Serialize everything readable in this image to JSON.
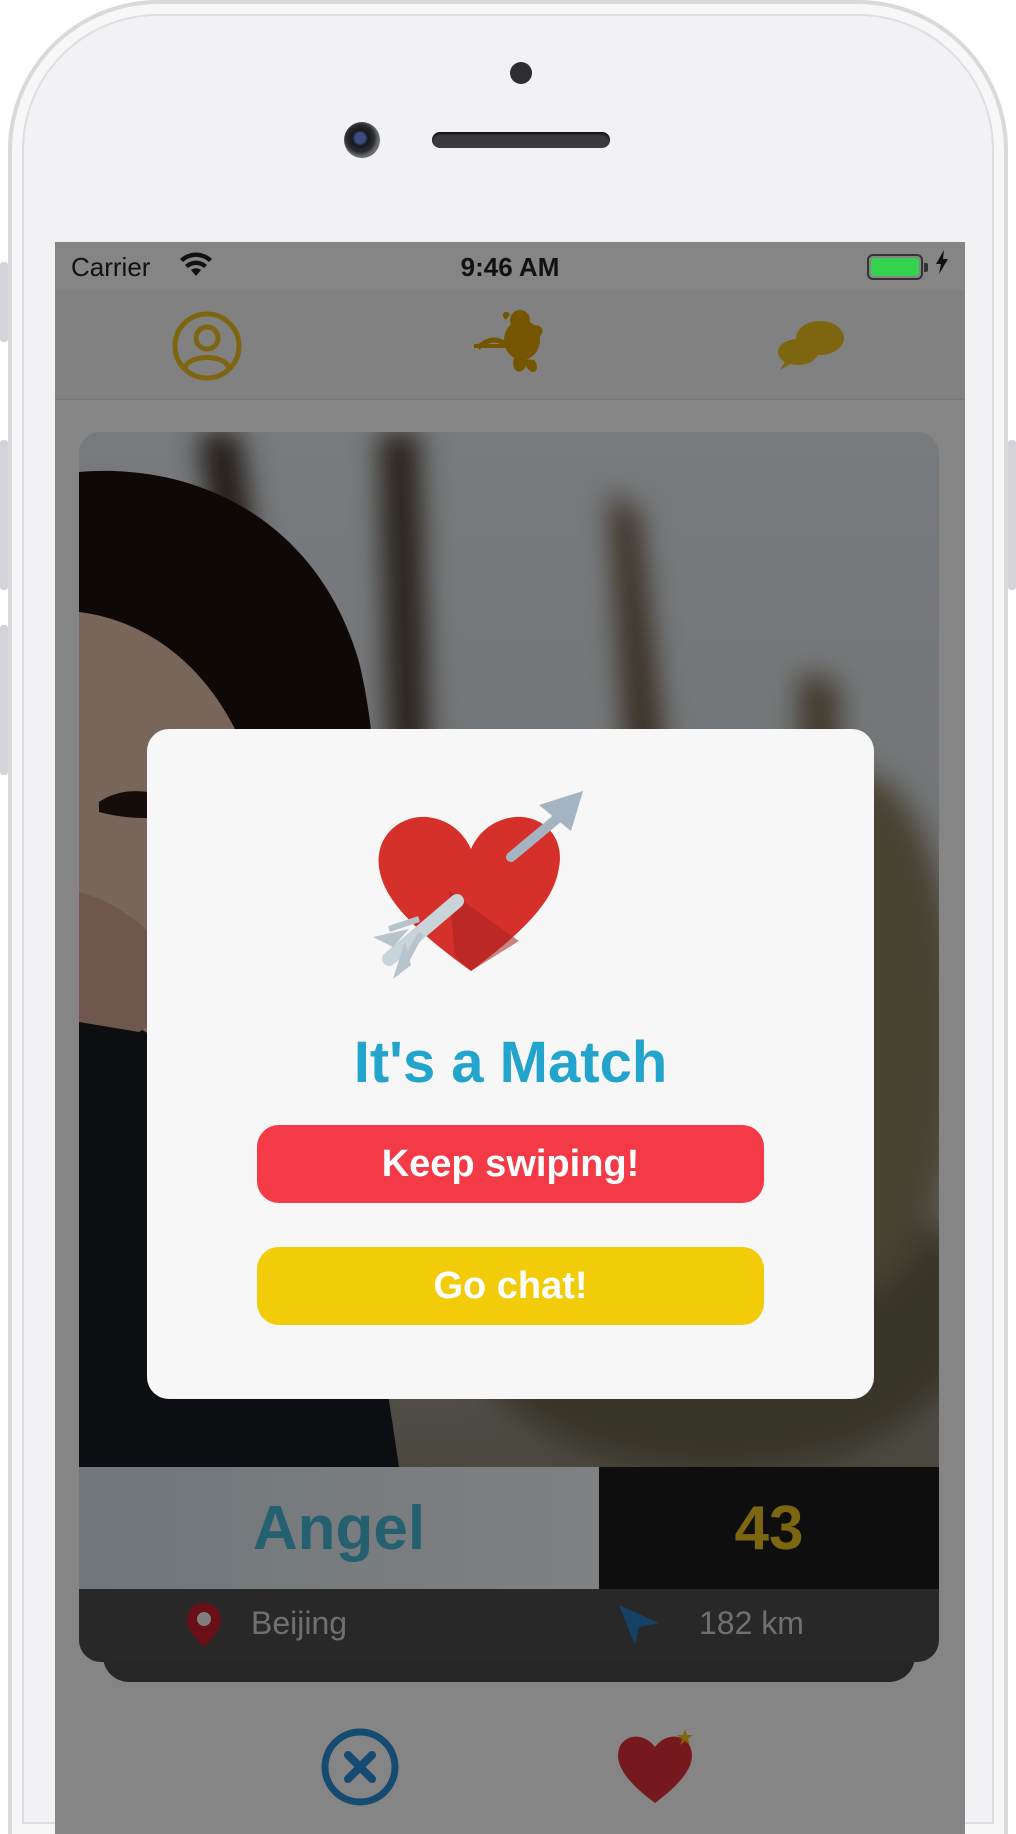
{
  "status_bar": {
    "carrier": "Carrier",
    "time": "9:46 AM",
    "battery_color": "#35d24f"
  },
  "tabs": [
    {
      "icon": "profile-icon",
      "selected": false
    },
    {
      "icon": "cupid-icon",
      "selected": true
    },
    {
      "icon": "chat-bubbles-icon",
      "selected": false
    }
  ],
  "accent_colors": {
    "tab_underline": "#b8112a",
    "tab_icons": "#f2c21d",
    "title": "#23a4cc",
    "keep_swiping": "#f43a47",
    "go_chat": "#f2cb09"
  },
  "profile": {
    "name": "Angel",
    "age": "43",
    "city": "Beijing",
    "distance": "182 km"
  },
  "match_dialog": {
    "icon": "heart-arrow-icon",
    "title": "It's a Match",
    "keep_swiping_label": "Keep swiping!",
    "go_chat_label": "Go chat!"
  },
  "bottom_actions": [
    {
      "icon": "dislike-x-icon"
    },
    {
      "icon": "like-heart-icon"
    }
  ]
}
